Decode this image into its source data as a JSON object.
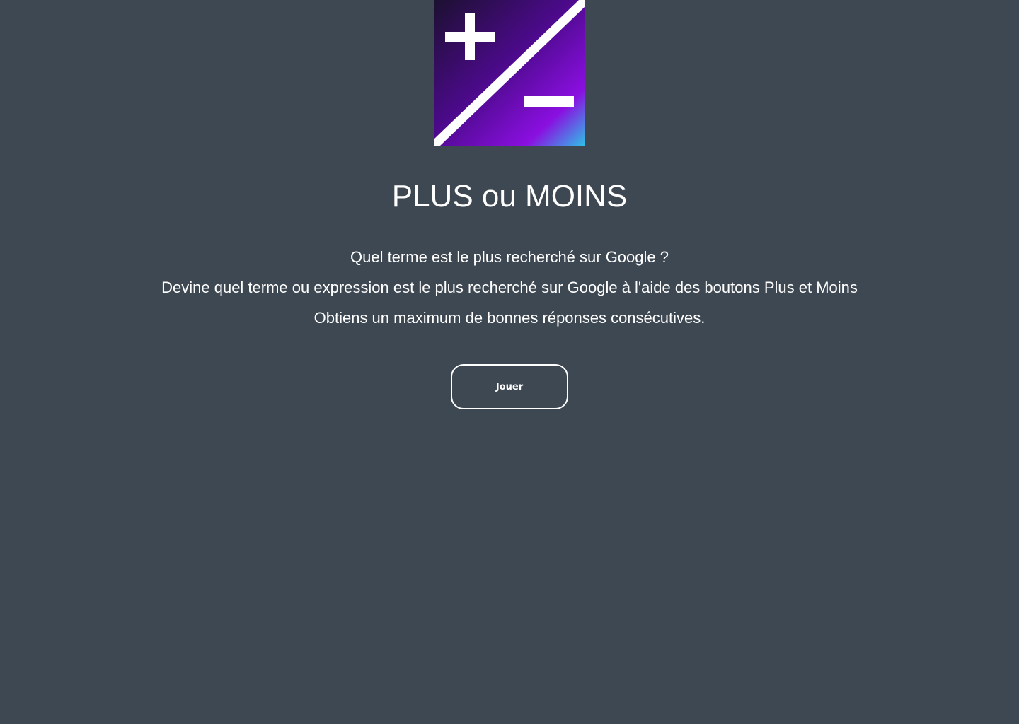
{
  "logo": {
    "icon": "plus-minus-logo-icon",
    "colors": {
      "dark": "#1c1030",
      "mid": "#4b0a8a",
      "accent": "#8a0fe0",
      "corner": "#2fc0e8",
      "stroke": "#ffffff"
    }
  },
  "title": "PLUS ou MOINS",
  "description": {
    "line1": "Quel terme est le plus recherché sur Google ?",
    "line2": "Devine quel terme ou expression est le plus recherché sur Google à l'aide des boutons Plus et Moins",
    "line3": "Obtiens un maximum de bonnes réponses consécutives."
  },
  "play_button": {
    "label": "Jouer"
  },
  "colors": {
    "background": "#3e4852",
    "text": "#ffffff"
  }
}
